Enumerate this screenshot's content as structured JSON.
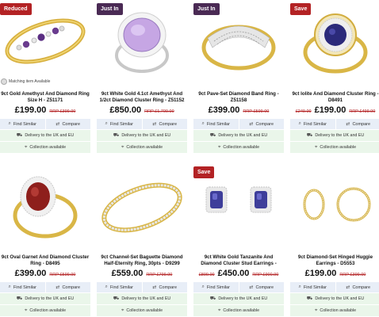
{
  "common": {
    "find_similar": "Find Similar",
    "compare": "Compare",
    "delivery": "Delivery to the UK and EU",
    "collection": "Collection available",
    "matching": "Matching item Available"
  },
  "products": [
    {
      "badge": "Reduced",
      "title": "9ct Gold Amethyst And Diamond Ring Size H - Z51171",
      "price": "£199.00",
      "rrp": "RRP £399.00",
      "was": ""
    },
    {
      "badge": "Just In",
      "title": "9ct White Gold 4.1ct Amethyst And 1/2ct Diamond Cluster Ring - Z51152",
      "price": "£850.00",
      "rrp": "RRP £1,700.00",
      "was": ""
    },
    {
      "badge": "Just In",
      "title": "9ct Pave-Set Diamond Band Ring - Z51158",
      "price": "£399.00",
      "rrp": "RRP £599.00",
      "was": ""
    },
    {
      "badge": "Save",
      "title": "9ct Iolite And Diamond Cluster Ring - D8491",
      "price": "£199.00",
      "rrp": "RRP £499.00",
      "was": "£249.00"
    },
    {
      "badge": "",
      "title": "9ct Oval Garnet And Diamond Cluster Ring - D8495",
      "price": "£399.00",
      "rrp": "RRP £599.00",
      "was": ""
    },
    {
      "badge": "",
      "title": "9ct Channel-Set Baguette Diamond Half-Eternity Ring, 30pts - D9299",
      "price": "£559.00",
      "rrp": "RRP £799.00",
      "was": ""
    },
    {
      "badge": "Save",
      "title": "9ct White Gold Tanzanite And Diamond Cluster Stud Earrings -",
      "price": "£450.00",
      "rrp": "RRP £900.00",
      "was": "£899.00"
    },
    {
      "badge": "",
      "title": "9ct Diamond-Set Hinged Huggie Earrings - D5553",
      "price": "£199.00",
      "rrp": "RRP £399.00",
      "was": ""
    }
  ]
}
